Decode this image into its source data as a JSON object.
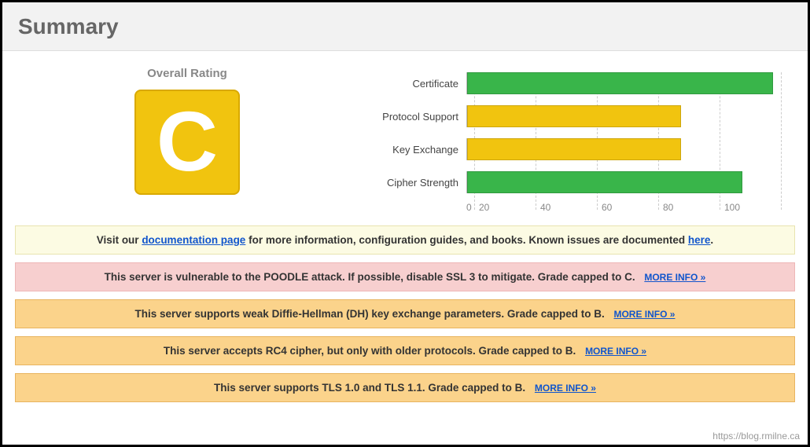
{
  "header": {
    "title": "Summary"
  },
  "rating": {
    "label": "Overall Rating",
    "grade": "C",
    "grade_color": "#f1c40f"
  },
  "chart_data": {
    "type": "bar",
    "categories": [
      "Certificate",
      "Protocol Support",
      "Key Exchange",
      "Cipher Strength"
    ],
    "values": [
      100,
      70,
      70,
      90
    ],
    "colors": [
      "#39b54a",
      "#f1c40f",
      "#f1c40f",
      "#39b54a"
    ],
    "ticks": [
      0,
      20,
      40,
      60,
      80,
      100
    ],
    "xlim": [
      0,
      100
    ]
  },
  "notices": [
    {
      "style": "info",
      "pre": "Visit our ",
      "link1_text": "documentation page",
      "mid": " for more information, configuration guides, and books. Known issues are documented ",
      "link2_text": "here",
      "post": "."
    },
    {
      "style": "danger",
      "text": "This server is vulnerable to the POODLE attack. If possible, disable SSL 3 to mitigate. Grade capped to C.",
      "more": "MORE INFO »"
    },
    {
      "style": "warn",
      "text": "This server supports weak Diffie-Hellman (DH) key exchange parameters. Grade capped to B.",
      "more": "MORE INFO »"
    },
    {
      "style": "warn",
      "text": "This server accepts RC4 cipher, but only with older protocols. Grade capped to B.",
      "more": "MORE INFO »"
    },
    {
      "style": "warn",
      "text": "This server supports TLS 1.0 and TLS 1.1. Grade capped to B.",
      "more": "MORE INFO »"
    }
  ],
  "watermark": "https://blog.rmilne.ca"
}
